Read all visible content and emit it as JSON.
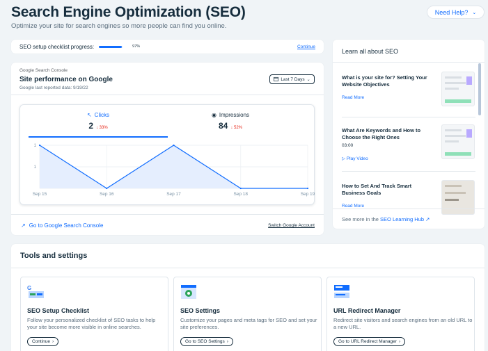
{
  "header": {
    "title": "Search Engine Optimization (SEO)",
    "subtitle": "Optimize your site for search engines so more people can find you online.",
    "help_label": "Need Help?"
  },
  "progress": {
    "label": "SEO setup checklist progress:",
    "percent_text": "97%",
    "value": 0.97,
    "continue_label": "Continue"
  },
  "gsc": {
    "logo_text": "Google Search Console",
    "title": "Site performance on Google",
    "last_reported": "Google last reported data: 9/19/22",
    "range_label": "Last 7 Days",
    "metrics": {
      "clicks": {
        "label": "Clicks",
        "value": "2",
        "delta": "33%"
      },
      "impressions": {
        "label": "Impressions",
        "value": "84",
        "delta": "52%"
      }
    },
    "go_link": "Go to Google Search Console",
    "switch_link": "Switch Google Account"
  },
  "chart_data": {
    "type": "area",
    "x": [
      "Sep 15",
      "Sep 16",
      "Sep 17",
      "Sep 18",
      "Sep 19"
    ],
    "series": [
      {
        "values": [
          1,
          0,
          1,
          0,
          0
        ]
      }
    ],
    "y_tick_labels": [
      "1",
      "1"
    ],
    "ylim": [
      0,
      1
    ],
    "grid": true
  },
  "learn": {
    "title": "Learn all about SEO",
    "items": [
      {
        "title": "What is your site for? Setting Your Website Objectives",
        "sub": "",
        "link": "Read More"
      },
      {
        "title": "What Are Keywords and How to Choose the Right Ones",
        "sub": "03:00",
        "link": "Play Video"
      },
      {
        "title": "How to Set And Track Smart Business Goals",
        "sub": "",
        "link": "Read More"
      }
    ],
    "see_more_prefix": "See more in the",
    "see_more_link": "SEO Learning Hub"
  },
  "tools": {
    "title": "Tools and settings",
    "items": [
      {
        "name": "SEO Setup Checklist",
        "desc": "Follow your personalized checklist of SEO tasks to help your site become more visible in online searches.",
        "button": "Continue"
      },
      {
        "name": "SEO Settings",
        "desc": "Customize your pages and meta tags for SEO and set your site preferences.",
        "button": "Go to SEO Settings"
      },
      {
        "name": "URL Redirect Manager",
        "desc": "Redirect site visitors and search engines from an old URL to a new URL.",
        "button": "Go to URL Redirect Manager"
      }
    ]
  },
  "colors": {
    "accent": "#116dff",
    "down": "#e62214",
    "text": "#162d3d",
    "background": "#f0f4f7"
  }
}
